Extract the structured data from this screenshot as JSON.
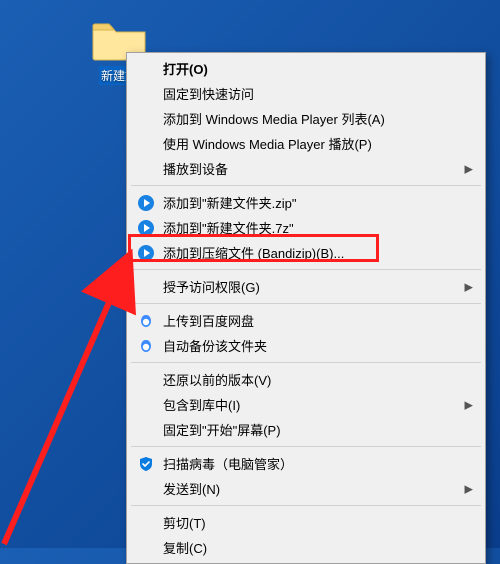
{
  "desktop": {
    "folder_label": "新建文"
  },
  "menu": {
    "open": "打开(O)",
    "pin_quick": "固定到快速访问",
    "add_wmp_list": "添加到 Windows Media Player 列表(A)",
    "play_wmp": "使用 Windows Media Player 播放(P)",
    "cast_to": "播放到设备",
    "add_zip": "添加到\"新建文件夹.zip\"",
    "add_7z": "添加到\"新建文件夹.7z\"",
    "add_archive": "添加到压缩文件 (Bandizip)(B)...",
    "grant_access": "授予访问权限(G)",
    "baidu_upload": "上传到百度网盘",
    "baidu_backup": "自动备份该文件夹",
    "restore_prev": "还原以前的版本(V)",
    "include_lib": "包含到库中(I)",
    "pin_start": "固定到\"开始\"屏幕(P)",
    "scan_virus": "扫描病毒（电脑管家）",
    "send_to": "发送到(N)",
    "cut": "剪切(T)",
    "copy": "复制(C)"
  },
  "icons": {
    "bandizip": "bandizip-icon",
    "baidu": "baidu-icon",
    "qqpc": "qqpc-shield-icon"
  },
  "colors": {
    "highlight": "#ff1e1e",
    "menu_bg": "#f0f0f0",
    "bandizip_blue": "#1a82e2",
    "qqpc_blue": "#0a7be0"
  }
}
